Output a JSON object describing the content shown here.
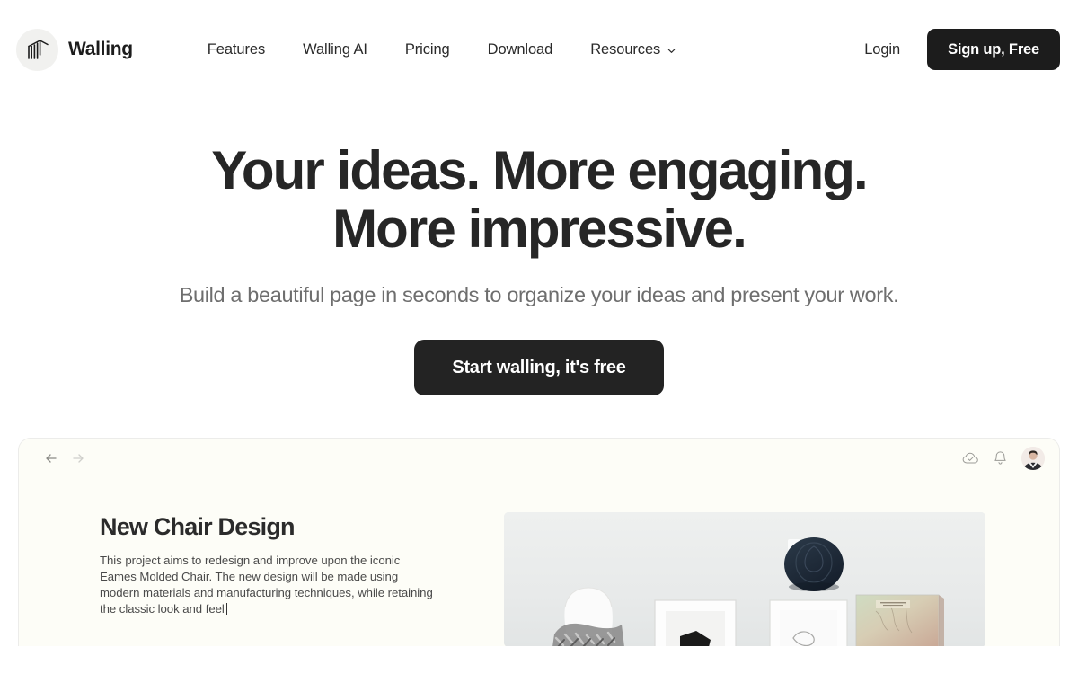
{
  "brand": {
    "name": "Walling",
    "logo_icon": "walling-building-icon"
  },
  "nav": {
    "items": [
      {
        "label": "Features",
        "has_dropdown": false
      },
      {
        "label": "Walling AI",
        "has_dropdown": false
      },
      {
        "label": "Pricing",
        "has_dropdown": false
      },
      {
        "label": "Download",
        "has_dropdown": false
      },
      {
        "label": "Resources",
        "has_dropdown": true
      }
    ],
    "login_label": "Login",
    "signup_label": "Sign up, Free"
  },
  "hero": {
    "title_line1": "Your ideas. More engaging.",
    "title_line2": "More impressive.",
    "subtitle": "Build a beautiful page in seconds to organize your ideas and present your work.",
    "cta_label": "Start walling, it's free"
  },
  "app_preview": {
    "topbar": {
      "back_icon": "arrow-left-icon",
      "forward_icon": "arrow-right-icon",
      "sync_icon": "cloud-check-icon",
      "notifications_icon": "bell-icon",
      "avatar_icon": "user-avatar"
    },
    "document": {
      "title": "New Chair Design",
      "body": "This project aims to redesign and improve upon the iconic Eames Molded Chair. The new design will be made using modern materials and manufacturing techniques, while retaining the classic look and feel",
      "photo_alt": "white wall with navy fedora hat, white molded chair and framed artwork"
    }
  },
  "colors": {
    "accent_dark": "#1c1c1c",
    "text_primary": "#262626",
    "text_muted": "#6e6e6e",
    "panel_bg": "#fdfdf7",
    "page_bg": "#ffffff"
  }
}
